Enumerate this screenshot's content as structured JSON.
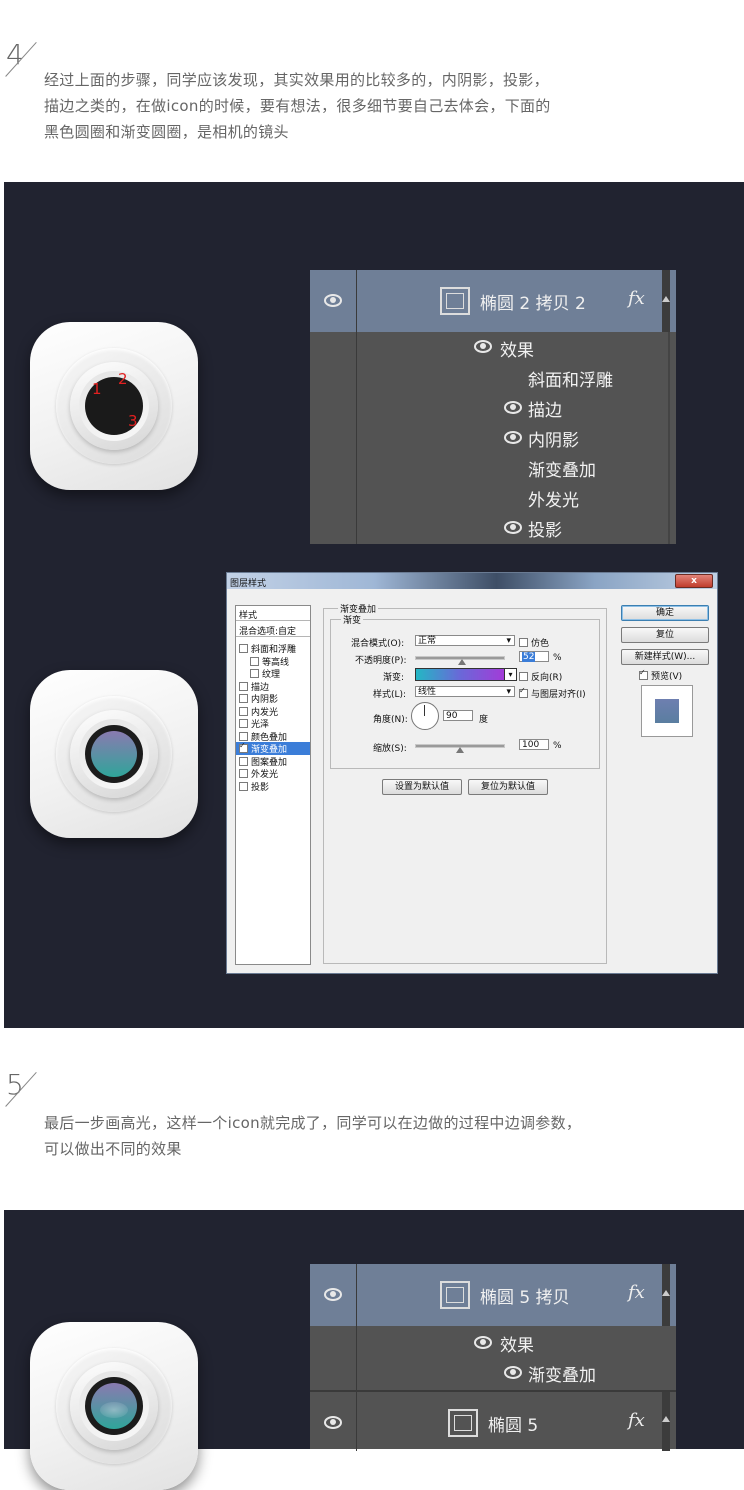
{
  "step4": {
    "number": "4",
    "text_line1": "经过上面的步骤，同学应该发现，其实效果用的比较多的，内阴影，投影，",
    "text_line2": "描边之类的，在做icon的时候，要有想法，很多细节要自己去体会，下面的",
    "text_line3": "黑色圆圈和渐变圆圈，是相机的镜头"
  },
  "step4_panel": {
    "markers": [
      "1",
      "2",
      "3"
    ],
    "layers": {
      "layer_name": "椭圆 2 拷贝 2",
      "fx_label": "fx",
      "effects_label": "效果",
      "effects": [
        {
          "label": "斜面和浮雕",
          "visible": false
        },
        {
          "label": "描边",
          "visible": true
        },
        {
          "label": "内阴影",
          "visible": true
        },
        {
          "label": "渐变叠加",
          "visible": false
        },
        {
          "label": "外发光",
          "visible": false
        },
        {
          "label": "投影",
          "visible": true
        }
      ]
    },
    "dialog": {
      "title": "图层样式",
      "close": "x",
      "styles_header": "样式",
      "blend_options": "混合选项:自定",
      "style_items": [
        {
          "label": "斜面和浮雕",
          "checked": false,
          "indent": false
        },
        {
          "label": "等高线",
          "checked": false,
          "indent": true
        },
        {
          "label": "纹理",
          "checked": false,
          "indent": true
        },
        {
          "label": "描边",
          "checked": false,
          "indent": false
        },
        {
          "label": "内阴影",
          "checked": false,
          "indent": false
        },
        {
          "label": "内发光",
          "checked": false,
          "indent": false
        },
        {
          "label": "光泽",
          "checked": false,
          "indent": false
        },
        {
          "label": "颜色叠加",
          "checked": false,
          "indent": false
        },
        {
          "label": "渐变叠加",
          "checked": true,
          "indent": false,
          "selected": true
        },
        {
          "label": "图案叠加",
          "checked": false,
          "indent": false
        },
        {
          "label": "外发光",
          "checked": false,
          "indent": false
        },
        {
          "label": "投影",
          "checked": false,
          "indent": false
        }
      ],
      "group_title": "渐变叠加",
      "subgroup_title": "渐变",
      "blend_mode_label": "混合模式(O):",
      "blend_mode_value": "正常",
      "dither_label": "仿色",
      "opacity_label": "不透明度(P):",
      "opacity_value": "52",
      "percent": "%",
      "gradient_label": "渐变:",
      "reverse_label": "反向(R)",
      "style_label": "样式(L):",
      "style_value": "线性",
      "align_label": "与图层对齐(I)",
      "angle_label": "角度(N):",
      "angle_value": "90",
      "degree": "度",
      "scale_label": "缩放(S):",
      "scale_value": "100",
      "set_default": "设置为默认值",
      "reset_default": "复位为默认值",
      "ok": "确定",
      "reset": "复位",
      "new_style": "新建样式(W)...",
      "preview": "预览(V)",
      "opacity_fraction": 0.52,
      "scale_fraction": 0.5,
      "gradient_colors": [
        "#23b7c4",
        "#6a68d8",
        "#a23cd8"
      ],
      "preview_swatch_colors": [
        "#6e7fb0",
        "#5a7ea0"
      ]
    }
  },
  "step5": {
    "number": "5",
    "text_line1": "最后一步画高光，这样一个icon就完成了，同学可以在边做的过程中边调参数，",
    "text_line2": "可以做出不同的效果"
  },
  "step5_panel": {
    "layer1_name": "椭圆 5 拷贝",
    "fx_label": "fx",
    "effects_label": "效果",
    "effect1": "渐变叠加",
    "layer2_name": "椭圆 5",
    "fx_label2": "fx"
  },
  "colors": {
    "dark_bg": "#212330",
    "panel_bg": "#535353",
    "selected_row": "#6f7f97",
    "lens_gradient_top": "#8a7ab0",
    "lens_gradient_bottom": "#2fa59a"
  }
}
